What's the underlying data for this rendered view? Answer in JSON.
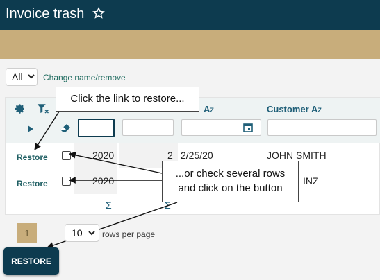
{
  "header": {
    "title": "Invoice trash"
  },
  "toolbar": {
    "view_select_value": "All",
    "change_link": "Change name/remove"
  },
  "grid": {
    "columns": {
      "customer": "Customer"
    },
    "rows": [
      {
        "action": "Restore",
        "year": "2020",
        "number": "2",
        "date": "2/25/20",
        "customer": "JOHN SMITH"
      },
      {
        "action": "Restore",
        "year": "2020",
        "number": "",
        "date": "",
        "customer": "INZ"
      }
    ],
    "footer": {
      "sigma": "Σ"
    }
  },
  "callouts": {
    "top": "Click the link to restore...",
    "right_line1": "...or check several rows",
    "right_line2": "and click on the button"
  },
  "pager": {
    "current_page": "1",
    "rows_per_page": "10",
    "rows_per_page_label": "rows per page"
  },
  "actions": {
    "restore_button": "RESTORE"
  },
  "colors": {
    "header": "#0d3b4f",
    "accent": "#c8ad7b",
    "link": "#1f6b5f"
  }
}
